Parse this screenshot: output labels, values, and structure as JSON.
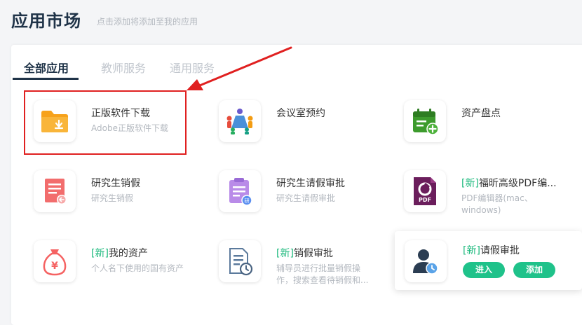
{
  "header": {
    "title": "应用市场",
    "subtitle": "点击添加将添加至我的应用"
  },
  "tabs": [
    {
      "label": "全部应用",
      "active": true
    },
    {
      "label": "教师服务",
      "active": false
    },
    {
      "label": "通用服务",
      "active": false
    }
  ],
  "apps": [
    {
      "tag": "",
      "name": "正版软件下载",
      "desc": "Adobe正版软件下载",
      "icon": "folder-download-icon"
    },
    {
      "tag": "",
      "name": "会议室预约",
      "desc": "",
      "icon": "meeting-room-icon"
    },
    {
      "tag": "",
      "name": "资产盘点",
      "desc": "",
      "icon": "calendar-add-icon"
    },
    {
      "tag": "",
      "name": "研究生销假",
      "desc": "研究生销假",
      "icon": "document-return-icon"
    },
    {
      "tag": "",
      "name": "研究生请假审批",
      "desc": "研究生请假审批",
      "icon": "clipboard-approve-icon"
    },
    {
      "tag": "新",
      "name": "福昕高级PDF编...",
      "desc": "PDF编辑器(mac、windows)",
      "icon": "pdf-editor-icon"
    },
    {
      "tag": "新",
      "name": "我的资产",
      "desc": "个人名下使用的国有资产",
      "icon": "money-bag-icon"
    },
    {
      "tag": "新",
      "name": "销假审批",
      "desc": "辅导员进行批量销假操作，搜索查看待销假和...",
      "icon": "document-clock-icon"
    }
  ],
  "hover_card": {
    "tag": "新",
    "name": "请假审批",
    "icon": "user-clock-icon",
    "enter_label": "进入",
    "add_label": "添加"
  },
  "colors": {
    "accent": "#1fc28a",
    "title": "#1f3348",
    "highlight": "#e02020",
    "tag": "#1bb97c"
  }
}
